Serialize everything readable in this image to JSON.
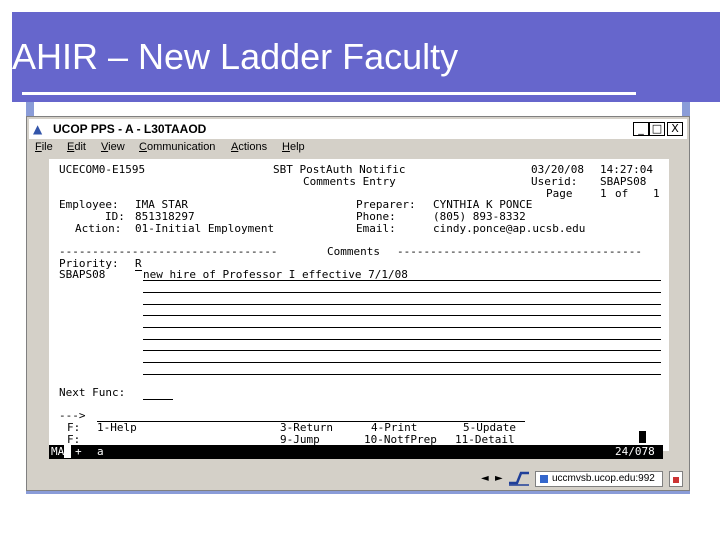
{
  "slide": {
    "title": "AHIR – New Ladder Faculty"
  },
  "window": {
    "title": "UCOP PPS - A - L30TAAOD",
    "buttons": {
      "minimize": "_",
      "maximize": "□",
      "close": "X"
    }
  },
  "menu": [
    {
      "label": "File",
      "mnemonic": "F",
      "rest": "ile"
    },
    {
      "label": "Edit",
      "mnemonic": "E",
      "rest": "dit"
    },
    {
      "label": "View",
      "mnemonic": "V",
      "rest": "iew"
    },
    {
      "label": "Communication",
      "mnemonic": "C",
      "rest": "ommunication"
    },
    {
      "label": "Actions",
      "mnemonic": "A",
      "rest": "ctions"
    },
    {
      "label": "Help",
      "mnemonic": "H",
      "rest": "elp"
    }
  ],
  "screen": {
    "screen_id": "UCECOM0-E1595",
    "header_line1": "SBT PostAuth Notific",
    "header_line2": "Comments Entry",
    "date": "03/20/08",
    "time": "14:27:04",
    "userid_label": "Userid:",
    "userid": "SBAPS08",
    "page_label": "Page",
    "page_current": "1",
    "page_of": "of",
    "page_total": "1",
    "employee_label": "Employee:",
    "employee": "IMA STAR",
    "id_label": "ID:",
    "id": "851318297",
    "action_label": "Action:",
    "action": "01-Initial Employment",
    "preparer_label": "Preparer:",
    "preparer": "CYNTHIA K PONCE",
    "phone_label": "Phone:",
    "phone": "(805) 893-8332",
    "email_label": "Email:",
    "email": "cindy.ponce@ap.ucsb.edu",
    "divider_left": "---------------------------------",
    "comments_heading": "Comments",
    "divider_right": "-------------------------------------",
    "priority_label": "Priority:",
    "priority": "R",
    "comment_user": "SBAPS08",
    "comment_text": "new hire of Professor I effective 7/1/08",
    "next_func_label": "Next Func:",
    "next_func_value": "",
    "cmd_prompt": "--->",
    "fkey_row1_label": "F:",
    "fkey_row1": [
      "1-Help",
      "3-Return",
      "4-Print",
      "5-Update"
    ],
    "fkey_row2_label": "F:",
    "fkey_row2": [
      "9-Jump",
      "10-NotfPrep",
      "11-Detail"
    ]
  },
  "status": {
    "mode": "MA",
    "indicator": "+",
    "field": "a",
    "cursor_pos": "24/078"
  },
  "toolbar": {
    "host": "uccmvsb.ucop.edu:992",
    "left_arrow": "◄",
    "right_arrow": "►"
  }
}
